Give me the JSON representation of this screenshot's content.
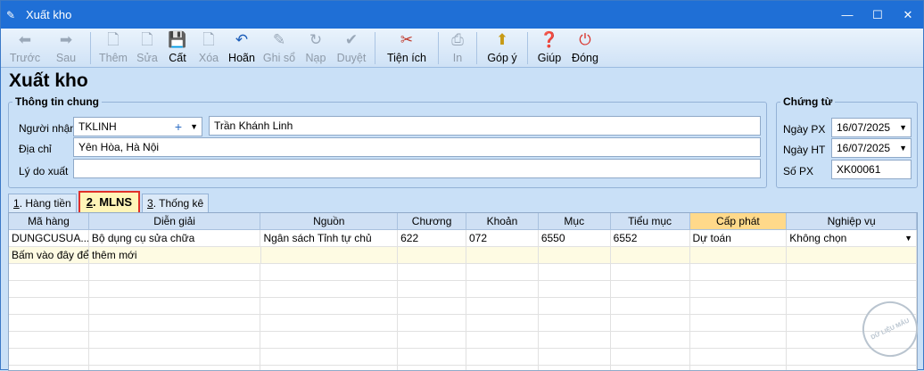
{
  "window": {
    "title": "Xuất kho",
    "minimize": "—",
    "maximize": "☐",
    "close": "✕"
  },
  "toolbar": {
    "back": "Trước",
    "forward": "Sau",
    "add": "Thêm",
    "edit": "Sửa",
    "save": "Cất",
    "delete": "Xóa",
    "undo": "Hoãn",
    "post": "Ghi sổ",
    "reload": "Nạp",
    "approve": "Duyệt",
    "utilities": "Tiện ích",
    "print": "In",
    "feedback": "Góp ý",
    "help": "Giúp",
    "close": "Đóng"
  },
  "page": {
    "heading": "Xuất kho"
  },
  "general": {
    "legend": "Thông tin chung",
    "recipient_label": "Người nhận",
    "recipient_code": "TKLINH",
    "recipient_name": "Trần Khánh Linh",
    "address_label": "Địa chỉ",
    "address": "Yên Hòa, Hà Nội",
    "reason_label": "Lý do xuất",
    "reason": ""
  },
  "voucher": {
    "legend": "Chứng từ",
    "px_date_label": "Ngày PX",
    "px_date": "16/07/2025",
    "ht_date_label": "Ngày HT",
    "ht_date": "16/07/2025",
    "px_no_label": "Số PX",
    "px_no": "XK00061"
  },
  "tabs": [
    {
      "num": "1",
      "label": ". Hàng tiền"
    },
    {
      "num": "2",
      "label": ". MLNS"
    },
    {
      "num": "3",
      "label": ". Thống kê"
    }
  ],
  "grid": {
    "columns": [
      "Mã hàng",
      "Diễn giải",
      "Nguồn",
      "Chương",
      "Khoản",
      "Mục",
      "Tiểu mục",
      "Cấp phát",
      "Nghiệp vụ"
    ],
    "row": [
      "DUNGCUSUA...",
      "Bộ dụng cụ sửa chữa",
      "Ngân sách Tỉnh tự chủ",
      "622",
      "072",
      "6550",
      "6552",
      "Dự toán",
      "Không chọn"
    ],
    "add_row": "Bấm vào đây để thêm mới"
  },
  "stamp": "DỮ LIỆU MẪU"
}
